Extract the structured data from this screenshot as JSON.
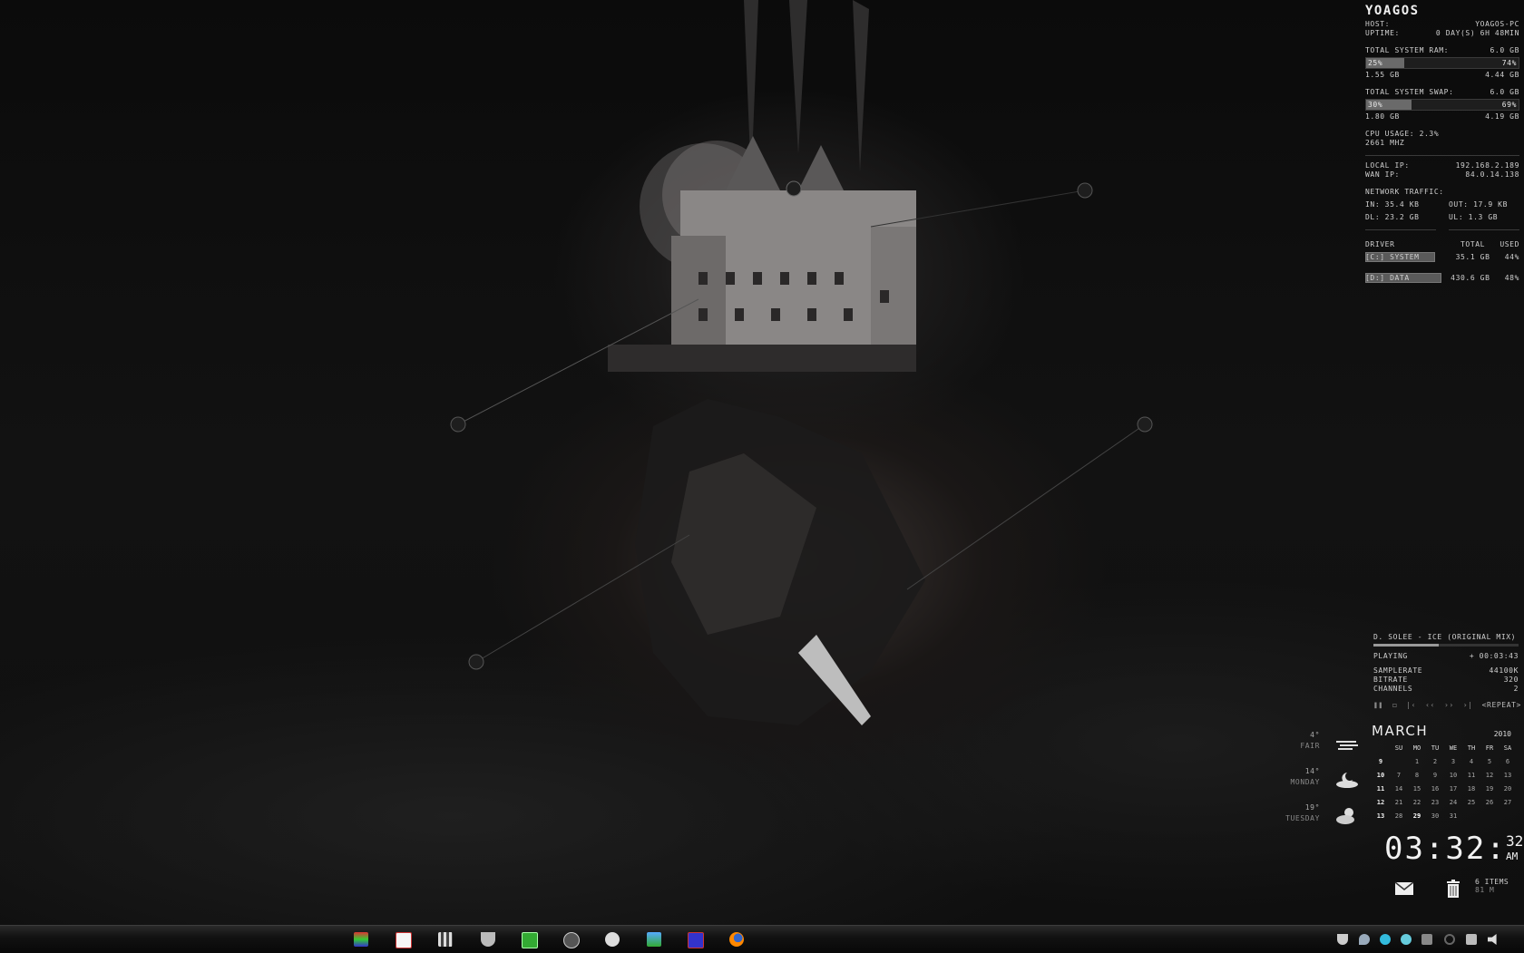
{
  "sysmon": {
    "title": "YOAGOS",
    "host_label": "HOST:",
    "host_value": "YOAGOS-PC",
    "uptime_label": "UPTIME:",
    "uptime_value": "0 DAY(S) 6H 48MIN",
    "ram_label": "TOTAL SYSTEM RAM:",
    "ram_total": "6.0 GB",
    "ram_used_pct": "25%",
    "ram_free_pct": "74%",
    "ram_used_fraction": 0.25,
    "ram_used": "1.55 GB",
    "ram_free": "4.44 GB",
    "swap_label": "TOTAL SYSTEM SWAP:",
    "swap_total": "6.0 GB",
    "swap_used_pct": "30%",
    "swap_free_pct": "69%",
    "swap_used_fraction": 0.3,
    "swap_used": "1.80 GB",
    "swap_free": "4.19 GB",
    "cpu_label": "CPU USAGE: 2.3%",
    "cpu_freq": "2661 MHZ",
    "local_ip_label": "LOCAL IP:",
    "local_ip": "192.168.2.189",
    "wan_ip_label": "WAN IP:",
    "wan_ip": "84.0.14.138",
    "net_label": "NETWORK TRAFFIC:",
    "net_in": "IN: 35.4 KB",
    "net_out": "OUT: 17.9 KB",
    "net_dl": "DL: 23.2 GB",
    "net_ul": "UL: 1.3 GB",
    "drives_header": {
      "name": "DRIVER",
      "total": "TOTAL",
      "used": "USED"
    },
    "drives": [
      {
        "name": "[C:] SYSTEM",
        "total": "35.1 GB",
        "used": "44%",
        "fraction": 0.44
      },
      {
        "name": "[D:] DATA",
        "total": "430.6 GB",
        "used": "48%",
        "fraction": 0.48
      }
    ]
  },
  "player": {
    "track": "D. SOLEE - ICE (ORIGINAL MIX)",
    "progress_fraction": 0.45,
    "status": "PLAYING",
    "time": "+ 00:03:43",
    "samplerate_label": "SAMPLERATE",
    "samplerate": "44100K",
    "bitrate_label": "BITRATE",
    "bitrate": "320",
    "channels_label": "CHANNELS",
    "channels": "2",
    "repeat": "<REPEAT>"
  },
  "calendar": {
    "month": "MARCH",
    "year": "2010",
    "days": [
      "SU",
      "MO",
      "TU",
      "WE",
      "TH",
      "FR",
      "SA"
    ],
    "weeks": [
      {
        "wk": "9",
        "d": [
          "",
          "1",
          "2",
          "3",
          "4",
          "5",
          "6"
        ]
      },
      {
        "wk": "10",
        "d": [
          "7",
          "8",
          "9",
          "10",
          "11",
          "12",
          "13"
        ]
      },
      {
        "wk": "11",
        "d": [
          "14",
          "15",
          "16",
          "17",
          "18",
          "19",
          "20"
        ]
      },
      {
        "wk": "12",
        "d": [
          "21",
          "22",
          "23",
          "24",
          "25",
          "26",
          "27"
        ]
      },
      {
        "wk": "13",
        "d": [
          "28",
          "29",
          "30",
          "31",
          "",
          "",
          ""
        ]
      }
    ],
    "today": "29"
  },
  "weather": [
    {
      "temp": "4°",
      "cond": "FAIR",
      "icon": "fog-icon"
    },
    {
      "temp": "14°",
      "cond": "MONDAY",
      "icon": "night-cloud-icon"
    },
    {
      "temp": "19°",
      "cond": "TUESDAY",
      "icon": "partly-sunny-icon"
    }
  ],
  "clock": {
    "hm": "03:32:",
    "sec": "32",
    "ampm": "AM"
  },
  "recycle": {
    "items": "6 ITEMS",
    "size": "81 M"
  },
  "taskbar": {
    "icons": [
      "media-folder-icon",
      "color-palette-icon",
      "clapperboard-icon",
      "shield-app-icon",
      "utorrent-icon",
      "steam-icon",
      "circle-logo-icon",
      "network-people-icon",
      "floppy-save-icon",
      "firefox-icon"
    ],
    "tray": [
      "antivirus-tray-icon",
      "drop-tray-icon",
      "skype-tray-icon",
      "moon-tray-icon",
      "monitor-tray-icon",
      "power-tray-icon",
      "network-tray-icon",
      "volume-tray-icon"
    ]
  }
}
